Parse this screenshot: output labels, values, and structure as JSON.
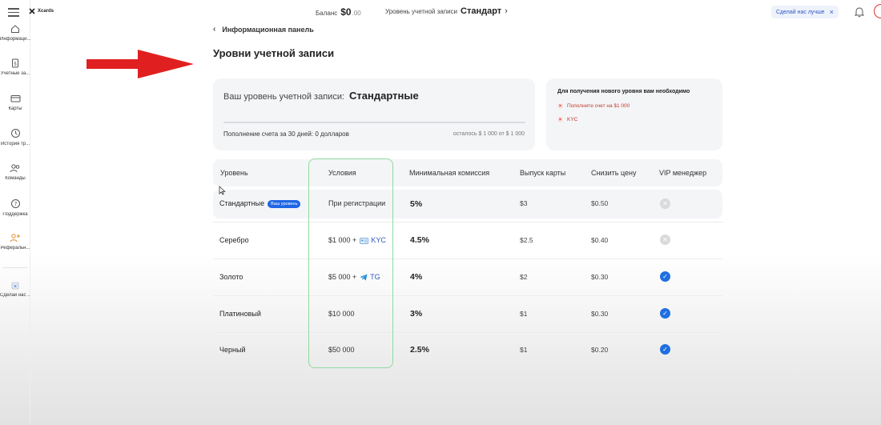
{
  "app": {
    "logo_text": "Xcards"
  },
  "topbar": {
    "balance_label": "Баланс",
    "balance_value": "$0",
    "balance_cents": ".00",
    "level_label": "Уровень учетной записи",
    "level_value": "Стандарт",
    "improve_label": "Сделай нас лучше"
  },
  "sidebar": {
    "items": [
      {
        "label": "Информаци...",
        "icon": "home-icon"
      },
      {
        "label": "Учетные за...",
        "icon": "document-dollar-icon"
      },
      {
        "label": "Карты",
        "icon": "card-icon"
      },
      {
        "label": "История тр...",
        "icon": "history-icon"
      },
      {
        "label": "Команды",
        "icon": "team-icon"
      },
      {
        "label": "Поддержка",
        "icon": "help-icon"
      },
      {
        "label": "Реферальн...",
        "icon": "referral-icon"
      },
      {
        "label": "Сделай нас ...",
        "icon": "feedback-icon"
      }
    ]
  },
  "breadcrumb": {
    "label": "Информационная панель"
  },
  "page": {
    "title": "Уровни учетной записи"
  },
  "level_card": {
    "label": "Ваш уровень учетной записи:",
    "value": "Стандартные",
    "progress": 0,
    "topup_text": "Пополнение счета за 30 дней: 0 долларов",
    "remaining_text": "осталось $ 1 000 от $ 1 000"
  },
  "requirements": {
    "title": "Для получения нового уровня вам необходимо",
    "items": [
      "Пополните счет на $1 000",
      "KYC"
    ]
  },
  "table": {
    "headers": [
      "Уровень",
      "Условия",
      "Минимальная комиссия",
      "Выпуск карты",
      "Снизить цену",
      "VIP менеджер"
    ],
    "your_level_badge": "Ваш уровень",
    "rows": [
      {
        "level": "Стандартные",
        "condition": "При регистрации",
        "commission": "5%",
        "card_issue": "$3",
        "reduce_price": "$0.50",
        "vip": false,
        "current": true
      },
      {
        "level": "Серебро",
        "condition_amount": "$1 000 +",
        "condition_extra": "KYC",
        "condition_icon": "id-card-icon",
        "commission": "4.5%",
        "card_issue": "$2.5",
        "reduce_price": "$0.40",
        "vip": false
      },
      {
        "level": "Золото",
        "condition_amount": "$5 000 +",
        "condition_extra": "TG",
        "condition_icon": "telegram-icon",
        "commission": "4%",
        "card_issue": "$2",
        "reduce_price": "$0.30",
        "vip": true
      },
      {
        "level": "Платиновый",
        "condition": "$10 000",
        "commission": "3%",
        "card_issue": "$1",
        "reduce_price": "$0.30",
        "vip": true
      },
      {
        "level": "Черный",
        "condition": "$50 000",
        "commission": "2.5%",
        "card_issue": "$1",
        "reduce_price": "$0.20",
        "vip": true
      }
    ]
  },
  "colors": {
    "accent": "#1f66e5",
    "annotation_arrow": "#e02020",
    "annotation_frame": "#8fd9a0",
    "error": "#d83a2e"
  }
}
